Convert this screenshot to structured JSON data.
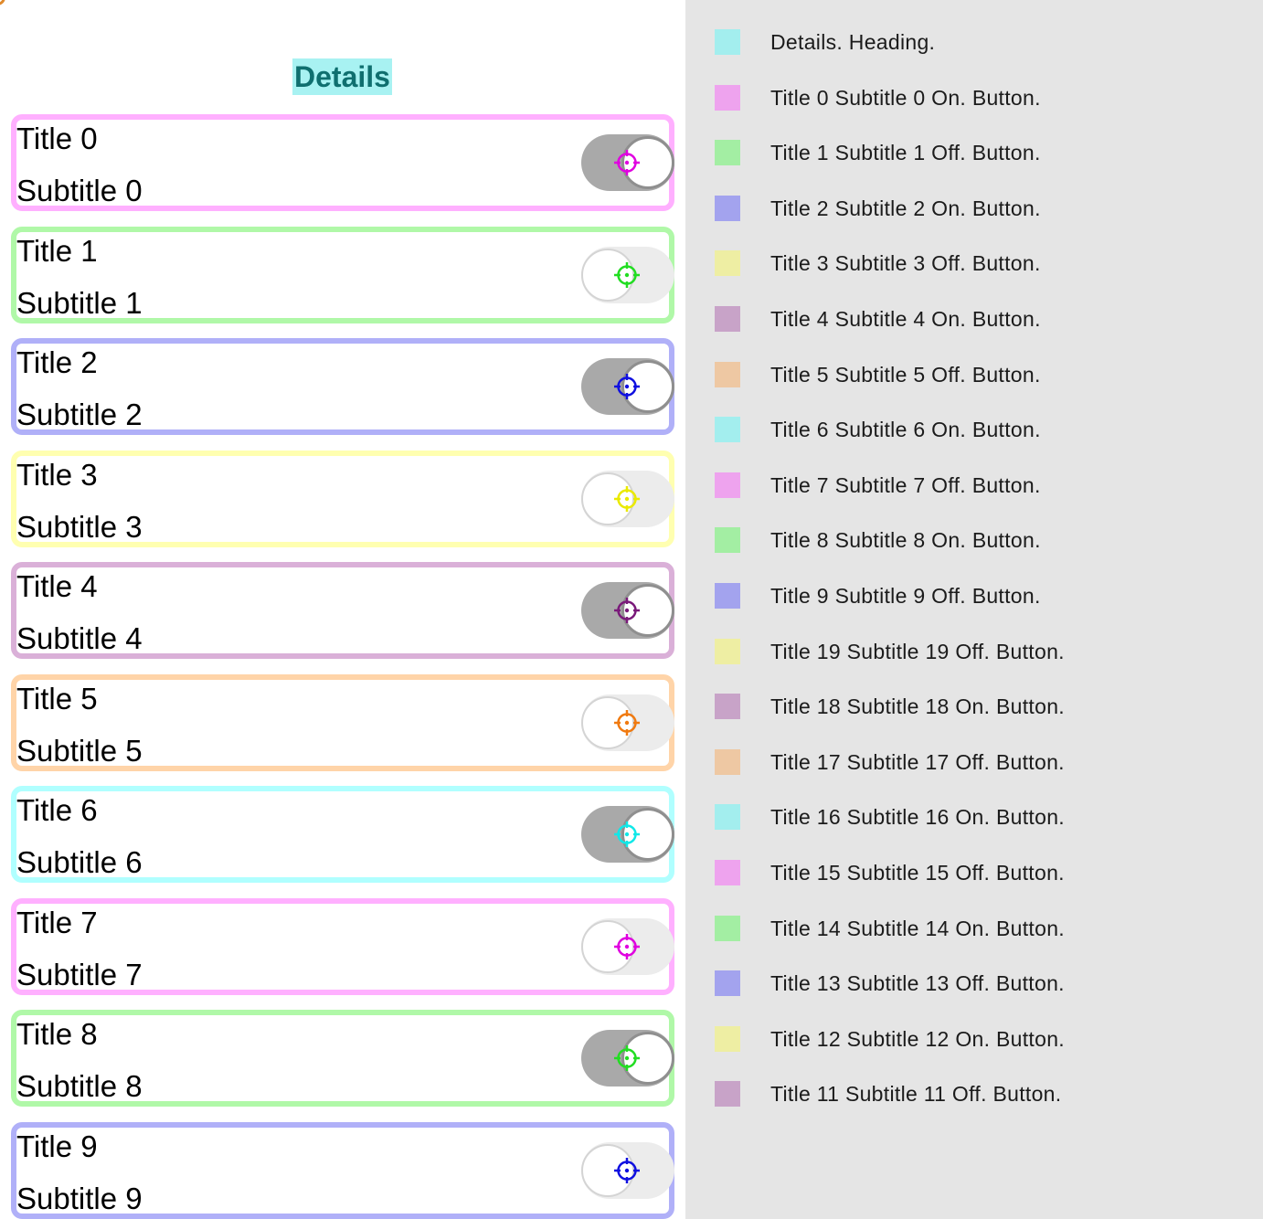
{
  "header": {
    "title": "Details"
  },
  "rows": [
    {
      "title": "Title 0",
      "subtitle": "Subtitle 0",
      "on": true,
      "color": "#ffb0ff",
      "icon_color": "#e000e0"
    },
    {
      "title": "Title 1",
      "subtitle": "Subtitle 1",
      "on": false,
      "color": "#b0f8a8",
      "icon_color": "#22dd22"
    },
    {
      "title": "Title 2",
      "subtitle": "Subtitle 2",
      "on": true,
      "color": "#b0b0f8",
      "icon_color": "#1010e0"
    },
    {
      "title": "Title 3",
      "subtitle": "Subtitle 3",
      "on": false,
      "color": "#ffffb0",
      "icon_color": "#eaea00"
    },
    {
      "title": "Title 4",
      "subtitle": "Subtitle 4",
      "on": true,
      "color": "#dab0d8",
      "icon_color": "#7a1a7a"
    },
    {
      "title": "Title 5",
      "subtitle": "Subtitle 5",
      "on": false,
      "color": "#ffd4a8",
      "icon_color": "#f07a10"
    },
    {
      "title": "Title 6",
      "subtitle": "Subtitle 6",
      "on": true,
      "color": "#b0ffff",
      "icon_color": "#10e8e8"
    },
    {
      "title": "Title 7",
      "subtitle": "Subtitle 7",
      "on": false,
      "color": "#ffb0ff",
      "icon_color": "#e000e0"
    },
    {
      "title": "Title 8",
      "subtitle": "Subtitle 8",
      "on": true,
      "color": "#b0f8a8",
      "icon_color": "#22dd22"
    },
    {
      "title": "Title 9",
      "subtitle": "Subtitle 9",
      "on": false,
      "color": "#b0b0f8",
      "icon_color": "#1010e0"
    }
  ],
  "legend": [
    {
      "text": "Details. Heading.",
      "color": "#a3eeee"
    },
    {
      "text": "Title 0 Subtitle 0 On. Button.",
      "color": "#eea3ee"
    },
    {
      "text": "Title 1 Subtitle 1 Off. Button.",
      "color": "#a3eea3"
    },
    {
      "text": "Title 2 Subtitle 2 On. Button.",
      "color": "#a3a3ee"
    },
    {
      "text": "Title 3 Subtitle 3 Off. Button.",
      "color": "#eeeea3"
    },
    {
      "text": "Title 4 Subtitle 4 On. Button.",
      "color": "#c8a3c8"
    },
    {
      "text": "Title 5 Subtitle 5 Off. Button.",
      "color": "#eec8a3"
    },
    {
      "text": "Title 6 Subtitle 6 On. Button.",
      "color": "#a3eeee"
    },
    {
      "text": "Title 7 Subtitle 7 Off. Button.",
      "color": "#eea3ee"
    },
    {
      "text": "Title 8 Subtitle 8 On. Button.",
      "color": "#a3eea3"
    },
    {
      "text": "Title 9 Subtitle 9 Off. Button.",
      "color": "#a3a3ee"
    },
    {
      "text": "Title 19 Subtitle 19 Off. Button.",
      "color": "#eeeea3"
    },
    {
      "text": "Title 18 Subtitle 18 On. Button.",
      "color": "#c8a3c8"
    },
    {
      "text": "Title 17 Subtitle 17 Off. Button.",
      "color": "#eec8a3"
    },
    {
      "text": "Title 16 Subtitle 16 On. Button.",
      "color": "#a3eeee"
    },
    {
      "text": "Title 15 Subtitle 15 Off. Button.",
      "color": "#eea3ee"
    },
    {
      "text": "Title 14 Subtitle 14 On. Button.",
      "color": "#a3eea3"
    },
    {
      "text": "Title 13 Subtitle 13 Off. Button.",
      "color": "#a3a3ee"
    },
    {
      "text": "Title 12 Subtitle 12 On. Button.",
      "color": "#eeeea3"
    },
    {
      "text": "Title 11 Subtitle 11 Off. Button.",
      "color": "#c8a3c8"
    }
  ]
}
